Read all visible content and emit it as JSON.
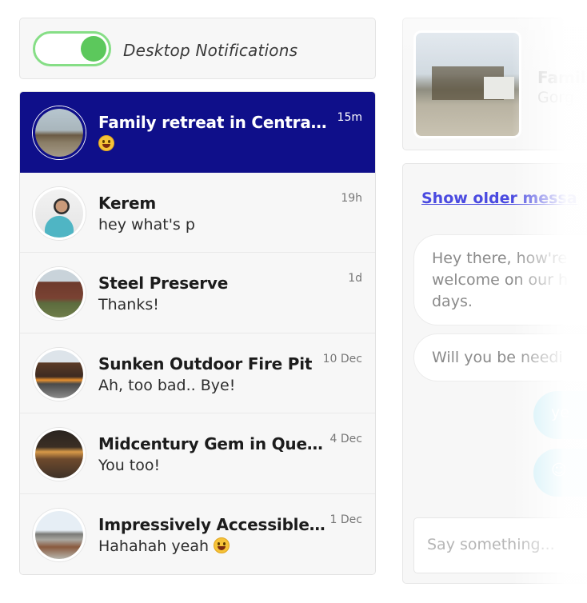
{
  "notifications": {
    "label": "Desktop Notifications",
    "enabled": true,
    "toggle_color": "#5cc85c"
  },
  "conversations": [
    {
      "title": "Family retreat in Central M...",
      "preview": "",
      "preview_emoji": "smile-emoji",
      "time": "15m",
      "active": true,
      "avatar": "cabin-photo"
    },
    {
      "title": "Kerem",
      "preview": "hey what's p",
      "time": "19h",
      "active": false,
      "avatar": "person-photo"
    },
    {
      "title": "Steel Preserve",
      "preview": "Thanks!",
      "time": "1d",
      "active": false,
      "avatar": "brick-house-photo"
    },
    {
      "title": "Sunken Outdoor Fire Pit",
      "preview": "Ah, too bad.. Bye!",
      "time": "10 Dec",
      "active": false,
      "avatar": "fire-pit-photo"
    },
    {
      "title": "Midcentury Gem in Quebec",
      "preview": "You too!",
      "time": "4 Dec",
      "active": false,
      "avatar": "midcentury-house-photo"
    },
    {
      "title": "Impressively Accessible H...",
      "preview": "Hahahah yeah",
      "preview_emoji": "smile-emoji",
      "time": "1 Dec",
      "active": false,
      "avatar": "modern-house-photo"
    }
  ],
  "listing": {
    "title": "Famil",
    "subtitle": "Gorg"
  },
  "chat": {
    "older_link": "Show older messa",
    "messages_in": [
      {
        "lines": [
          "Hey there, how're",
          "welcome on our h",
          "days."
        ]
      },
      {
        "lines": [
          "Will you be needi"
        ]
      }
    ],
    "messages_out": [
      {
        "text": "ye"
      },
      {
        "text": "☺"
      }
    ],
    "composer_placeholder": "Say something..."
  },
  "colors": {
    "active_row": "#0f0f8a",
    "link": "#4a4ae0",
    "outgoing_bubble": "#cdeef7"
  }
}
